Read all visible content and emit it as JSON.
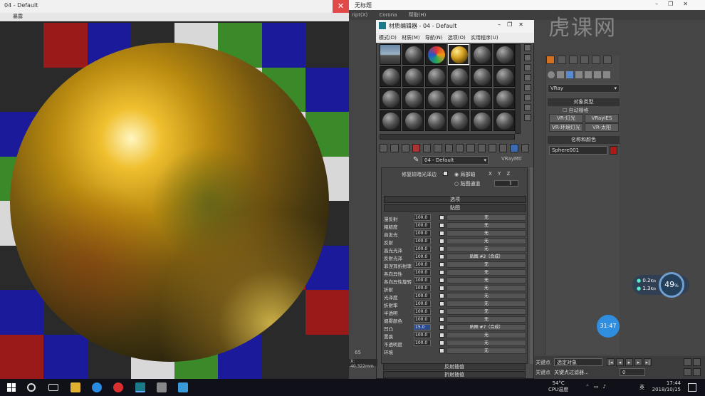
{
  "render_window": {
    "title": "04 - Default",
    "menu": [
      "",
      "暴露"
    ],
    "close": "✕"
  },
  "checker_colors": [
    "#2a2a2a",
    "#3a8a2a",
    "#1a1a9a",
    "#2a2a2a",
    "#d8d8d8",
    "#9a1a1a",
    "#1a1a9a",
    "#2a2a2a"
  ],
  "max_window": {
    "title": "无标题",
    "menu": [
      "ript(X)",
      "Corona",
      "帮助(H)"
    ]
  },
  "watermark": "虎课网",
  "command_panel": {
    "renderer": "VRay",
    "object_type_header": "对象类型",
    "auto_grid": "自动栅格",
    "buttons": [
      "VR-灯光",
      "VRayIES",
      "VR-环境灯光",
      "VR-太阳"
    ],
    "name_color_header": "名称和颜色",
    "object_name": "Sphere001"
  },
  "network": {
    "up": "0.2",
    "up_unit": "K/s",
    "down": "1.3",
    "down_unit": "K/s",
    "percent": "49",
    "percent_unit": "%"
  },
  "timer_bubble": "31:47",
  "material_editor": {
    "title": "材质编辑器 - 04 - Default",
    "menu": [
      "模式(D)",
      "材质(M)",
      "导航(N)",
      "选项(O)",
      "实用程序(U)"
    ],
    "material_name": "04 - Default",
    "material_type": "VRayMtl",
    "top_option": "修复较暗光泽边",
    "local_axis": "局部轴",
    "map_channel": "贴图通道",
    "axes": [
      "X",
      "Y",
      "Z"
    ],
    "channel_value": "1",
    "rollout_options": "选项",
    "rollout_maps": "贴图",
    "maps": [
      {
        "label": "漫反射",
        "value": "100.0",
        "map": "无"
      },
      {
        "label": "粗糙度",
        "value": "100.0",
        "map": "无"
      },
      {
        "label": "自发光",
        "value": "100.0",
        "map": "无"
      },
      {
        "label": "反射",
        "value": "100.0",
        "map": "无"
      },
      {
        "label": "高光光泽",
        "value": "100.0",
        "map": "无"
      },
      {
        "label": "反射光泽",
        "value": "100.0",
        "map": "贴图 #2（合成）"
      },
      {
        "label": "菲涅耳折射率",
        "value": "100.0",
        "map": "无"
      },
      {
        "label": "各向异性",
        "value": "100.0",
        "map": "无"
      },
      {
        "label": "各向异性旋转",
        "value": "100.0",
        "map": "无"
      },
      {
        "label": "折射",
        "value": "100.0",
        "map": "无"
      },
      {
        "label": "光泽度",
        "value": "100.0",
        "map": "无"
      },
      {
        "label": "折射率",
        "value": "100.0",
        "map": "无"
      },
      {
        "label": "半透明",
        "value": "100.0",
        "map": "无"
      },
      {
        "label": "烟雾颜色",
        "value": "100.0",
        "map": "无"
      },
      {
        "label": "凹凸",
        "value": "15.0",
        "map": "贴图 #7（合成）"
      },
      {
        "label": "置换",
        "value": "100.0",
        "map": "无"
      },
      {
        "label": "不透明度",
        "value": "100.0",
        "map": "无"
      },
      {
        "label": "环境",
        "value": "",
        "map": "无"
      }
    ],
    "rollout_reflect_interp": "反射插值",
    "rollout_refract_interp": "折射插值"
  },
  "timeline": {
    "frame": "65",
    "coord_label": "X:",
    "coord_value": "40.322mm",
    "key_point_label": "关键点",
    "key_mode": "选定对象",
    "key_filter": "关键点过滤器...",
    "frame_value": "0"
  },
  "taskbar": {
    "temp": "54°C",
    "temp_label": "CPU温度",
    "ime": "英",
    "time": "17:44",
    "date": "2018/10/15"
  }
}
